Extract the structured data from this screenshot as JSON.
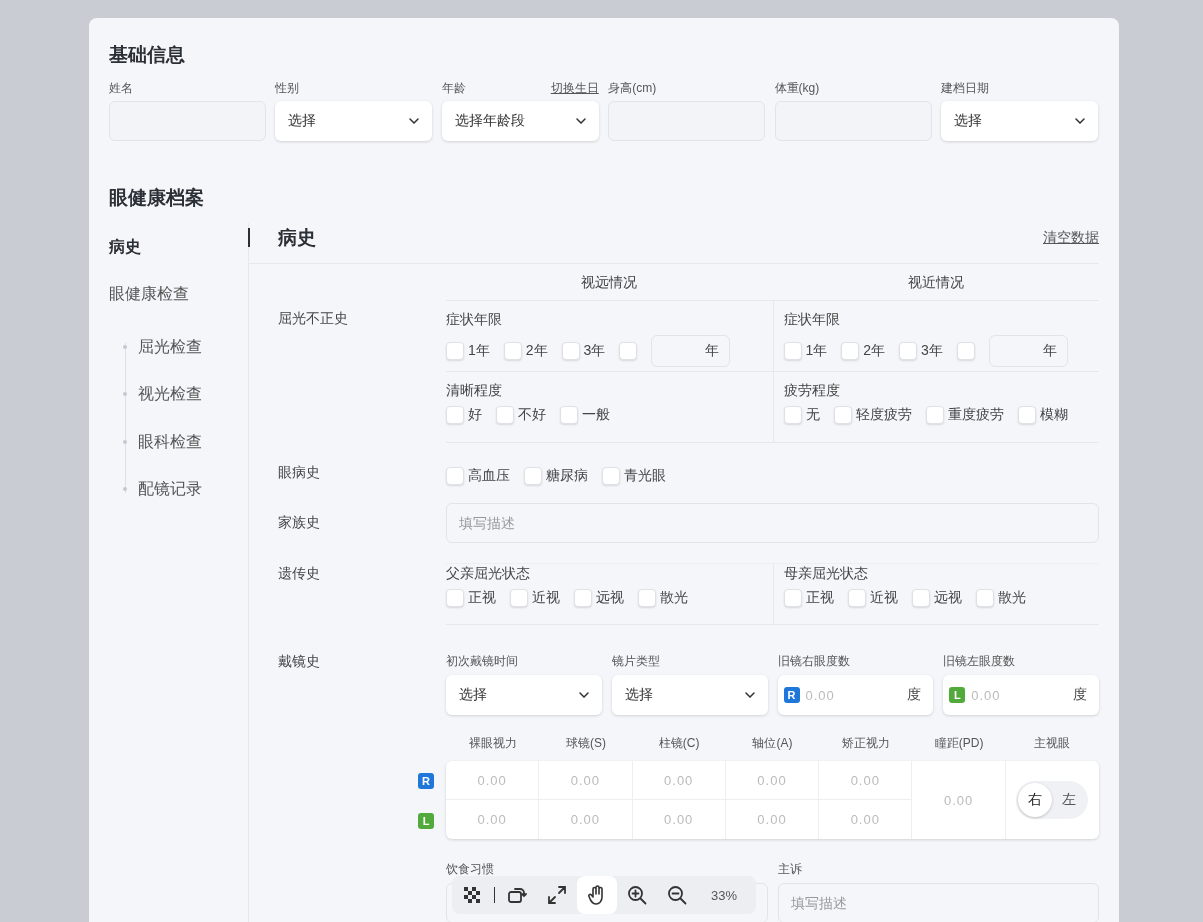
{
  "basic_info": {
    "title": "基础信息",
    "fields": [
      {
        "label": "姓名",
        "kind": "input"
      },
      {
        "label": "性别",
        "kind": "select",
        "value": "选择"
      },
      {
        "label": "年龄",
        "kind": "select",
        "value": "选择年龄段",
        "link": "切换生日"
      },
      {
        "label": "身高(cm)",
        "kind": "input"
      },
      {
        "label": "体重(kg)",
        "kind": "input"
      },
      {
        "label": "建档日期",
        "kind": "select",
        "value": "选择"
      }
    ]
  },
  "eye_health": {
    "title": "眼健康档案",
    "nav": [
      {
        "label": "病史",
        "selected": true
      },
      {
        "label": "眼健康检查",
        "selected": false,
        "children": [
          {
            "label": "屈光检查",
            "selected": false
          },
          {
            "label": "视光检查",
            "selected": false
          },
          {
            "label": "眼科检查",
            "selected": false
          },
          {
            "label": "配镜记录",
            "selected": false
          }
        ]
      }
    ]
  },
  "panel": {
    "title": "病史",
    "clear_link": "清空数据",
    "refraction": {
      "label": "屈光不正史",
      "columns": [
        {
          "heading": "视远情况",
          "groups": [
            {
              "title": "症状年限",
              "options": [
                {
                  "label": "1年",
                  "checked": false
                },
                {
                  "label": "2年",
                  "checked": false
                },
                {
                  "label": "3年",
                  "checked": false
                }
              ],
              "custom": {
                "checked": false,
                "unit": "年"
              }
            },
            {
              "title": "清晰程度",
              "options": [
                {
                  "label": "好",
                  "checked": false
                },
                {
                  "label": "不好",
                  "checked": false
                },
                {
                  "label": "一般",
                  "checked": false
                }
              ]
            }
          ]
        },
        {
          "heading": "视近情况",
          "groups": [
            {
              "title": "症状年限",
              "options": [
                {
                  "label": "1年",
                  "checked": false
                },
                {
                  "label": "2年",
                  "checked": false
                },
                {
                  "label": "3年",
                  "checked": false
                }
              ],
              "custom": {
                "checked": false,
                "unit": "年"
              }
            },
            {
              "title": "疲劳程度",
              "options": [
                {
                  "label": "无",
                  "checked": false
                },
                {
                  "label": "轻度疲劳",
                  "checked": false
                },
                {
                  "label": "重度疲劳",
                  "checked": false
                },
                {
                  "label": "模糊",
                  "checked": false
                }
              ]
            }
          ]
        }
      ]
    },
    "eye_disease": {
      "label": "眼病史",
      "options": [
        {
          "label": "高血压",
          "checked": false
        },
        {
          "label": "糖尿病",
          "checked": false
        },
        {
          "label": "青光眼",
          "checked": false
        }
      ]
    },
    "family": {
      "label": "家族史",
      "placeholder": "填写描述"
    },
    "genetic": {
      "label": "遗传史",
      "groups": [
        {
          "title": "父亲屈光状态",
          "options": [
            {
              "label": "正视",
              "checked": false
            },
            {
              "label": "近视",
              "checked": false
            },
            {
              "label": "远视",
              "checked": false
            },
            {
              "label": "散光",
              "checked": false
            }
          ]
        },
        {
          "title": "母亲屈光状态",
          "options": [
            {
              "label": "正视",
              "checked": false
            },
            {
              "label": "近视",
              "checked": false
            },
            {
              "label": "远视",
              "checked": false
            },
            {
              "label": "散光",
              "checked": false
            }
          ]
        }
      ]
    },
    "glasses": {
      "label": "戴镜史",
      "fields": [
        {
          "label": "初次戴镜时间",
          "kind": "select",
          "value": "选择"
        },
        {
          "label": "镜片类型",
          "kind": "select",
          "value": "选择"
        },
        {
          "label": "旧镜右眼度数",
          "kind": "degree",
          "eye": "R",
          "color": "#1f78d9",
          "placeholder": "0.00",
          "unit": "度"
        },
        {
          "label": "旧镜左眼度数",
          "kind": "degree",
          "eye": "L",
          "color": "#52a93c",
          "placeholder": "0.00",
          "unit": "度"
        }
      ],
      "table": {
        "columns": [
          "裸眼视力",
          "球镜(S)",
          "柱镜(C)",
          "轴位(A)",
          "矫正视力",
          "瞳距(PD)",
          "主视眼"
        ],
        "rows": [
          {
            "eye": "R",
            "color": "#1f78d9",
            "cells": [
              "0.00",
              "0.00",
              "0.00",
              "0.00",
              "0.00"
            ]
          },
          {
            "eye": "L",
            "color": "#52a93c",
            "cells": [
              "0.00",
              "0.00",
              "0.00",
              "0.00",
              "0.00"
            ]
          }
        ],
        "pd": "0.00",
        "dominant": [
          {
            "label": "右",
            "selected": true
          },
          {
            "label": "左",
            "selected": false
          }
        ]
      }
    },
    "bottom_fields": [
      {
        "label": "饮食习惯"
      },
      {
        "label": "主诉",
        "placeholder": "填写描述"
      }
    ]
  },
  "viewer_toolbar": {
    "tools": [
      {
        "kind": "checker",
        "selected": false
      },
      {
        "kind": "rotate",
        "selected": false
      },
      {
        "kind": "fit",
        "selected": false
      },
      {
        "kind": "pan",
        "selected": true
      },
      {
        "kind": "zoom_in",
        "selected": false
      },
      {
        "kind": "zoom_out",
        "selected": false
      }
    ],
    "zoom": "33%"
  }
}
